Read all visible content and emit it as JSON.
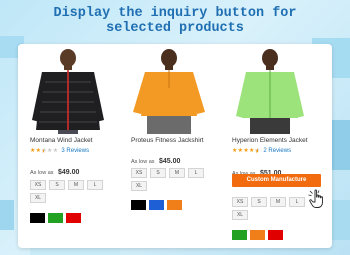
{
  "headline": {
    "line1": "Display the inquiry button for",
    "line2": "selected products"
  },
  "colors": {
    "headline": "#1f6fb2",
    "star": "#f39c12",
    "review_link": "#1979c3",
    "button": "#f26b0f"
  },
  "products": [
    {
      "name": "Montana Wind Jacket",
      "rating_stars": 2.5,
      "reviews": "3  Reviews",
      "price_prefix": "As low as",
      "price": "$49.00",
      "sizes": [
        "XS",
        "S",
        "M",
        "L",
        "XL"
      ],
      "swatches": [
        "#000000",
        "#22a122",
        "#e00000"
      ],
      "image": "man in black puffer jacket with red zipper"
    },
    {
      "name": "Proteus Fitness Jackshirt",
      "price_prefix": "As low as",
      "price": "$45.00",
      "sizes": [
        "XS",
        "S",
        "M",
        "L",
        "XL"
      ],
      "swatches": [
        "#000000",
        "#1f5fd6",
        "#f07f1a"
      ],
      "image": "man in orange half-zip jackshirt"
    },
    {
      "name": "Hyperion Elements Jacket",
      "rating_stars": 4.5,
      "reviews": "2  Reviews",
      "price_prefix": "As low as",
      "price": "$51.00",
      "button_label": "Custom Manufacture",
      "sizes": [
        "XS",
        "S",
        "M",
        "L",
        "XL"
      ],
      "swatches": [
        "#22a122",
        "#f07f1a",
        "#e00000"
      ],
      "image": "man in light green zip jacket"
    }
  ]
}
